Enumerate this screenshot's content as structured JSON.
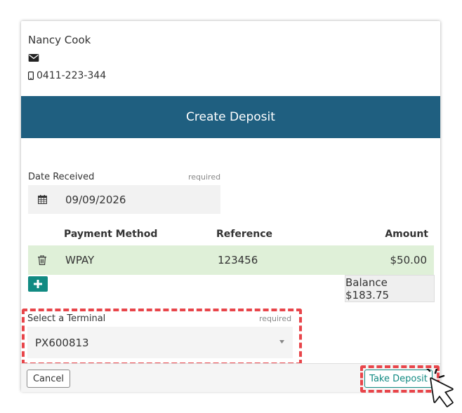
{
  "contact": {
    "name": "Nancy Cook",
    "phone": "0411-223-344",
    "email_icon": "envelope-icon",
    "phone_icon": "mobile-phone-icon"
  },
  "header": {
    "title": "Create Deposit"
  },
  "date": {
    "label": "Date Received",
    "required": "required",
    "value": "09/09/2026",
    "icon": "calendar-icon"
  },
  "payments": {
    "columns": [
      "Payment Method",
      "Reference",
      "Amount"
    ],
    "rows": [
      {
        "method": "WPAY",
        "reference": "123456",
        "amount": "$50.00"
      }
    ],
    "balance": "Balance $183.75"
  },
  "terminal": {
    "label": "Select a Terminal",
    "required": "required",
    "value": "PX600813"
  },
  "footer": {
    "cancel_label": "Cancel",
    "take_deposit_label": "Take Deposit"
  },
  "colors": {
    "header_bg": "#1f5f80",
    "accent": "#118a82",
    "row_bg": "#dff0d8",
    "highlight": "#e8454a"
  }
}
